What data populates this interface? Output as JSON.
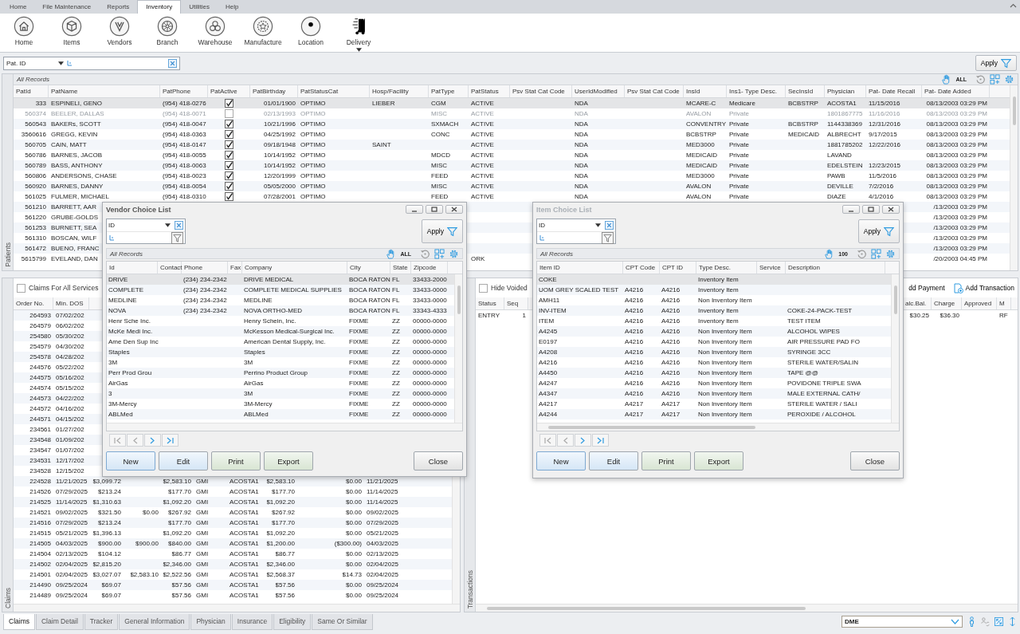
{
  "menu_tabs": [
    {
      "label": "Home",
      "selected": false
    },
    {
      "label": "File Maintenance",
      "selected": false
    },
    {
      "label": "Reports",
      "selected": false
    },
    {
      "label": "Inventory",
      "selected": true
    },
    {
      "label": "Utilities",
      "selected": false
    },
    {
      "label": "Help",
      "selected": false
    }
  ],
  "ribbon": [
    {
      "label": "Home",
      "kind": "home",
      "has_menu": false
    },
    {
      "label": "Items",
      "kind": "items",
      "has_menu": false
    },
    {
      "label": "Vendors",
      "kind": "vendors",
      "has_menu": false
    },
    {
      "label": "Branch",
      "kind": "branch",
      "has_menu": false
    },
    {
      "label": "Warehouse",
      "kind": "warehouse",
      "has_menu": false
    },
    {
      "label": "Manufacture",
      "kind": "manufacturer",
      "has_menu": false
    },
    {
      "label": "Location",
      "kind": "location",
      "has_menu": false
    },
    {
      "label": "Delivery",
      "kind": "delivery",
      "has_menu": true
    }
  ],
  "filter": {
    "field": "Pat. ID",
    "button": "Apply"
  },
  "records_bar": {
    "label": "All Records",
    "count": "ALL"
  },
  "patients": {
    "side_label": "Patients",
    "columns": [
      "PatId",
      "PatName",
      "PatPhone",
      "PatActive",
      "PatBirthday",
      "PatStatusCat",
      "Hosp/Facility",
      "PatType",
      "PatStatus",
      "Psv Stat Cat Code",
      "UserIdModified",
      "Psv Stat Cat Code",
      "InsId",
      "Ins1- Type Desc.",
      "SecInsId",
      "Physician",
      "Pat- Date Recall",
      "Pat- Date Added"
    ],
    "rows": [
      {
        "selected": true,
        "disabled": false,
        "active": true,
        "cells": [
          "333",
          "ESPINELI, GENO",
          "(954) 418-0276",
          null,
          "01/01/1900",
          "OPTIMO",
          "LIEBER",
          "CGM",
          "ACTIVE",
          null,
          "NDA",
          null,
          "MCARE-C",
          "Medicare",
          "BCBSTRP",
          "ACOSTA1",
          "11/15/2016",
          "08/13/2003 03:29 PM"
        ]
      },
      {
        "selected": false,
        "disabled": true,
        "active": false,
        "cells": [
          "560374",
          "BEELER, DALLAS",
          "(954) 418-0071",
          null,
          "02/13/1993",
          "OPTIMO",
          null,
          "MISC",
          "ACTIVE",
          null,
          "NDA",
          null,
          "AVALON",
          "Private",
          null,
          "1801867775",
          "11/16/2016",
          "08/13/2003 03:29 PM"
        ]
      },
      {
        "selected": false,
        "disabled": false,
        "active": true,
        "cells": [
          "560543",
          "BAKERs, SCOTT",
          "(954) 418-0047",
          null,
          "10/21/1996",
          "OPTIMO",
          null,
          "SXMACH",
          "ACTIVE",
          null,
          "NDA",
          null,
          "CONVENTRY",
          "Private",
          "BCBSTRP",
          "1144338369",
          "12/31/2016",
          "08/13/2003 03:29 PM"
        ]
      },
      {
        "selected": false,
        "disabled": false,
        "active": true,
        "cells": [
          "3560616",
          "GREGG, KEVIN",
          "(954) 418-0363",
          null,
          "04/25/1992",
          "OPTIMO",
          null,
          "CONC",
          "ACTIVE",
          null,
          "NDA",
          null,
          "BCBSTRP",
          "Private",
          "MEDICAID",
          "ALBRECHT",
          "9/17/2015",
          "08/13/2003 03:29 PM"
        ]
      },
      {
        "selected": false,
        "disabled": false,
        "active": true,
        "cells": [
          "560705",
          "CAIN, MATT",
          "(954) 418-0147",
          null,
          "09/18/1948",
          "OPTIMO",
          "SAINT",
          null,
          "ACTIVE",
          null,
          "NDA",
          null,
          "MED3000",
          "Private",
          null,
          "1881785202",
          "12/22/2016",
          "08/13/2003 03:29 PM"
        ]
      },
      {
        "selected": false,
        "disabled": false,
        "active": true,
        "cells": [
          "560786",
          "BARNES, JACOB",
          "(954) 418-0055",
          null,
          "10/14/1952",
          "OPTIMO",
          null,
          "MDCD",
          "ACTIVE",
          null,
          "NDA",
          null,
          "MEDICAID",
          "Private",
          null,
          "LAVAND",
          null,
          "08/13/2003 03:29 PM"
        ]
      },
      {
        "selected": false,
        "disabled": false,
        "active": true,
        "cells": [
          "560789",
          "BASS, ANTHONY",
          "(954) 418-0063",
          null,
          "10/14/1952",
          "OPTIMO",
          null,
          "MISC",
          "ACTIVE",
          null,
          "NDA",
          null,
          "MEDICAID",
          "Private",
          null,
          "EDELSTEIN",
          "12/23/2015",
          "08/13/2003 03:29 PM"
        ]
      },
      {
        "selected": false,
        "disabled": false,
        "active": true,
        "cells": [
          "560806",
          "ANDERSONS, CHASE",
          "(954) 418-0023",
          null,
          "12/20/1999",
          "OPTIMO",
          null,
          "FEED",
          "ACTIVE",
          null,
          "NDA",
          null,
          "MED3000",
          "Private",
          null,
          "PAWB",
          "11/5/2016",
          "08/13/2003 03:29 PM"
        ]
      },
      {
        "selected": false,
        "disabled": false,
        "active": true,
        "cells": [
          "560920",
          "BARNES, DANNY",
          "(954) 418-0054",
          null,
          "05/05/2000",
          "OPTIMO",
          null,
          "MISC",
          "ACTIVE",
          null,
          "NDA",
          null,
          "AVALON",
          "Private",
          null,
          "DEVILLE",
          "7/2/2016",
          "08/13/2003 03:29 PM"
        ]
      },
      {
        "selected": false,
        "disabled": false,
        "active": true,
        "cells": [
          "561025",
          "FULMER, MICHAEL",
          "(954) 418-0310",
          null,
          "07/28/2001",
          "OPTIMO",
          null,
          "FEED",
          "ACTIVE",
          null,
          "NDA",
          null,
          "AVALON",
          "Private",
          null,
          "DIAZE",
          "4/1/2016",
          "08/13/2003 03:29 PM"
        ]
      },
      {
        "selected": false,
        "disabled": false,
        "cells": [
          "561210",
          "BARRETT, AAR",
          null,
          null,
          null,
          null,
          null,
          null,
          null,
          null,
          null,
          null,
          null,
          null,
          null,
          null,
          null,
          "/13/2003 03:29 PM"
        ]
      },
      {
        "selected": false,
        "disabled": false,
        "cells": [
          "561220",
          "GRUBE-GOLDS",
          null,
          null,
          null,
          null,
          null,
          null,
          null,
          null,
          null,
          null,
          null,
          null,
          null,
          null,
          null,
          "/13/2003 03:29 PM"
        ]
      },
      {
        "selected": false,
        "disabled": false,
        "cells": [
          "561253",
          "BURNETT, SEA",
          null,
          null,
          null,
          null,
          null,
          null,
          null,
          null,
          null,
          null,
          null,
          null,
          null,
          null,
          null,
          "/13/2003 03:29 PM"
        ]
      },
      {
        "selected": false,
        "disabled": false,
        "cells": [
          "561310",
          "BOSCAN, WILF",
          null,
          null,
          null,
          null,
          null,
          null,
          null,
          null,
          null,
          null,
          null,
          null,
          null,
          null,
          null,
          "/13/2003 03:29 PM"
        ]
      },
      {
        "selected": false,
        "disabled": false,
        "cells": [
          "561472",
          "BUENO, FRANC",
          null,
          null,
          null,
          null,
          null,
          null,
          null,
          null,
          null,
          null,
          null,
          null,
          null,
          null,
          null,
          "/13/2003 03:29 PM"
        ]
      },
      {
        "selected": false,
        "disabled": false,
        "cells": [
          "5615799",
          "EVELAND, DAN",
          null,
          null,
          null,
          null,
          null,
          null,
          "ORK",
          null,
          null,
          null,
          null,
          null,
          null,
          null,
          null,
          "/20/2003 04:45 PM"
        ]
      }
    ]
  },
  "claims": {
    "side_label": "Claims",
    "all_services": {
      "label": "Claims For All Services",
      "checked": false
    },
    "columns": [
      "Order No.",
      "Min. DOS",
      null,
      null,
      null,
      null,
      null,
      null,
      null,
      null
    ],
    "rows": [
      {
        "cells": [
          "264593",
          "07/02/202",
          null,
          null,
          null,
          null,
          null,
          null,
          null,
          null
        ]
      },
      {
        "cells": [
          "264579",
          "06/02/202",
          null,
          null,
          null,
          null,
          null,
          null,
          null,
          null
        ]
      },
      {
        "cells": [
          "254580",
          "05/30/202",
          null,
          null,
          null,
          null,
          null,
          null,
          null,
          null
        ]
      },
      {
        "cells": [
          "254579",
          "04/30/202",
          null,
          null,
          null,
          null,
          null,
          null,
          null,
          null
        ]
      },
      {
        "cells": [
          "254578",
          "04/28/202",
          null,
          null,
          null,
          null,
          null,
          null,
          null,
          null
        ]
      },
      {
        "cells": [
          "244576",
          "05/22/202",
          null,
          null,
          null,
          null,
          null,
          null,
          null,
          null
        ]
      },
      {
        "cells": [
          "244575",
          "05/16/202",
          null,
          null,
          null,
          null,
          null,
          null,
          null,
          null
        ]
      },
      {
        "cells": [
          "244574",
          "05/15/202",
          null,
          null,
          null,
          null,
          null,
          null,
          null,
          null
        ]
      },
      {
        "cells": [
          "244573",
          "04/22/202",
          null,
          null,
          null,
          null,
          null,
          null,
          null,
          null
        ]
      },
      {
        "cells": [
          "244572",
          "04/16/202",
          null,
          null,
          null,
          null,
          null,
          null,
          null,
          null
        ]
      },
      {
        "cells": [
          "244571",
          "04/15/202",
          null,
          null,
          null,
          null,
          null,
          null,
          null,
          null
        ]
      },
      {
        "cells": [
          "234561",
          "01/27/202",
          null,
          null,
          null,
          null,
          null,
          null,
          null,
          null
        ]
      },
      {
        "cells": [
          "234548",
          "01/09/202",
          null,
          null,
          null,
          null,
          null,
          null,
          null,
          null
        ]
      },
      {
        "cells": [
          "234547",
          "01/07/202",
          null,
          null,
          null,
          null,
          null,
          null,
          null,
          null
        ]
      },
      {
        "cells": [
          "234531",
          "12/17/202",
          null,
          null,
          null,
          null,
          null,
          null,
          null,
          null
        ]
      },
      {
        "cells": [
          "234528",
          "12/15/202",
          null,
          null,
          null,
          null,
          null,
          null,
          null,
          null
        ]
      },
      {
        "cells": [
          "224528",
          "11/21/2025",
          "$3,099.72",
          null,
          "$2,583.10",
          "GMI",
          "ACOSTA1",
          "$2,583.10",
          "$0.00",
          "11/21/2025"
        ]
      },
      {
        "cells": [
          "214526",
          "07/29/2025",
          "$213.24",
          null,
          "$177.70",
          "GMI",
          "ACOSTA1",
          "$177.70",
          "$0.00",
          "11/14/2025"
        ]
      },
      {
        "cells": [
          "214525",
          "11/14/2025",
          "$1,310.63",
          null,
          "$1,092.20",
          "GMI",
          "ACOSTA1",
          "$1,092.20",
          "$0.00",
          "11/14/2025"
        ]
      },
      {
        "cells": [
          "214521",
          "09/02/2025",
          "$321.50",
          "$0.00",
          "$267.92",
          "GMI",
          "ACOSTA1",
          "$267.92",
          "$0.00",
          "09/02/2025"
        ]
      },
      {
        "cells": [
          "214516",
          "07/29/2025",
          "$213.24",
          null,
          "$177.70",
          "GMI",
          "ACOSTA1",
          "$177.70",
          "$0.00",
          "07/29/2025"
        ]
      },
      {
        "cells": [
          "214515",
          "05/21/2025",
          "$1,396.13",
          null,
          "$1,092.20",
          "GMI",
          "ACOSTA1",
          "$1,092.20",
          "$0.00",
          "05/21/2025"
        ]
      },
      {
        "cells": [
          "214505",
          "04/03/2025",
          "$900.00",
          "$900.00",
          "$840.00",
          "GMI",
          "ACOSTA1",
          "$1,200.00",
          "($300.00)",
          "04/03/2025"
        ]
      },
      {
        "cells": [
          "214504",
          "02/13/2025",
          "$104.12",
          null,
          "$86.77",
          "GMI",
          "ACOSTA1",
          "$86.77",
          "$0.00",
          "02/13/2025"
        ]
      },
      {
        "cells": [
          "214502",
          "02/04/2025",
          "$2,815.20",
          null,
          "$2,346.00",
          "GMI",
          "ACOSTA1",
          "$2,346.00",
          "$0.00",
          "02/04/2025"
        ]
      },
      {
        "cells": [
          "214501",
          "02/04/2025",
          "$3,027.07",
          "$2,583.10",
          "$2,522.56",
          "GMI",
          "ACOSTA1",
          "$2,568.37",
          "$14.73",
          "02/04/2025"
        ]
      },
      {
        "cells": [
          "214490",
          "09/25/2024",
          "$69.07",
          null,
          "$57.56",
          "GMI",
          "ACOSTA1",
          "$57.56",
          "$0.00",
          "09/25/2024"
        ]
      },
      {
        "cells": [
          "214489",
          "09/25/2024",
          "$69.07",
          null,
          "$57.56",
          "GMI",
          "ACOSTA1",
          "$57.56",
          "$0.00",
          "09/25/2024"
        ]
      }
    ]
  },
  "transactions": {
    "side_label": "Transactions",
    "hide_voided": {
      "label": "Hide Voided",
      "checked": false
    },
    "actions": [
      "dd Payment",
      "Add Transaction"
    ],
    "columns": [
      "Status",
      "Seq",
      "alc.Bal.",
      "Charge",
      "Approved",
      "M"
    ],
    "rows": [
      {
        "cells": [
          "ENTRY",
          "1",
          "$30.25",
          "$36.30",
          null,
          "RF"
        ]
      }
    ]
  },
  "dialogs": [
    {
      "title": "Vendor Choice List",
      "active": true,
      "filter": {
        "field": "ID",
        "button": "Apply"
      },
      "records": {
        "label": "All Records",
        "count": "ALL"
      },
      "columns": [
        "Id",
        "Contact",
        "Phone",
        "Fax",
        "Company",
        "City",
        "State",
        "Zipcode"
      ],
      "rows": [
        {
          "selected": true,
          "cells": [
            "DRIVE",
            null,
            "(234) 234-2342",
            null,
            "DRIVE MEDICAL",
            "BOCA RATON",
            "FL",
            "33433-2000"
          ]
        },
        {
          "selected": false,
          "cells": [
            "COMPLETE",
            null,
            "(234) 234-2342",
            null,
            "COMPLETE MEDICAL SUPPLIES",
            "BOCA RATON",
            "FL",
            "33433-0000"
          ]
        },
        {
          "selected": false,
          "cells": [
            "MEDLINE",
            null,
            "(234) 234-2342",
            null,
            "MEDLINE",
            "BOCA RATON",
            "FL",
            "33433-0000"
          ]
        },
        {
          "selected": false,
          "cells": [
            "NOVA",
            null,
            "(234) 234-2342",
            null,
            "NOVA ORTHO-MED",
            "BOCA RATON",
            "FL",
            "33343-4333"
          ]
        },
        {
          "selected": false,
          "cells": [
            "Henr Sche Inc.",
            null,
            null,
            null,
            "Henry Schein, Inc.",
            "FIXME",
            "ZZ",
            "00000-0000"
          ]
        },
        {
          "selected": false,
          "cells": [
            "McKe Medi Inc.",
            null,
            null,
            null,
            "McKesson Medical-Surgical Inc.",
            "FIXME",
            "ZZ",
            "00000-0000"
          ]
        },
        {
          "selected": false,
          "cells": [
            "Ame Den Sup Inc",
            null,
            null,
            null,
            "American Dental Supply, Inc.",
            "FIXME",
            "ZZ",
            "00000-0000"
          ]
        },
        {
          "selected": false,
          "cells": [
            "Staples",
            null,
            null,
            null,
            "Staples",
            "FIXME",
            "ZZ",
            "00000-0000"
          ]
        },
        {
          "selected": false,
          "cells": [
            "3M",
            null,
            null,
            null,
            "3M",
            "FIXME",
            "ZZ",
            "00000-0000"
          ]
        },
        {
          "selected": false,
          "cells": [
            "Perr Prod Grou",
            null,
            null,
            null,
            "Perrino Product Group",
            "FIXME",
            "ZZ",
            "00000-0000"
          ]
        },
        {
          "selected": false,
          "cells": [
            "AirGas",
            null,
            null,
            null,
            "AirGas",
            "FIXME",
            "ZZ",
            "00000-0000"
          ]
        },
        {
          "selected": false,
          "cells": [
            "3",
            null,
            null,
            null,
            "3M",
            "FIXME",
            "ZZ",
            "00000-0000"
          ]
        },
        {
          "selected": false,
          "cells": [
            "3M-Mercy",
            null,
            null,
            null,
            "3M-Mercy",
            "FIXME",
            "ZZ",
            "00000-0000"
          ]
        },
        {
          "selected": false,
          "cells": [
            "ABLMed",
            null,
            null,
            null,
            "ABLMed",
            "FIXME",
            "ZZ",
            "00000-0000"
          ]
        }
      ],
      "buttons": [
        {
          "label": "New",
          "kind": "create"
        },
        {
          "label": "Edit",
          "kind": "edit"
        },
        {
          "label": "Print",
          "kind": "print"
        },
        {
          "label": "Export",
          "kind": "export"
        },
        {
          "label": "Close",
          "kind": "close"
        }
      ]
    },
    {
      "title": "Item Choice List",
      "active": false,
      "filter": {
        "field": "ID",
        "button": "Apply"
      },
      "records": {
        "label": "All Records",
        "count": "100"
      },
      "columns": [
        "Item ID",
        "CPT Code",
        "CPT ID",
        "Type Desc.",
        "Service",
        "Description"
      ],
      "rows": [
        {
          "selected": true,
          "cells": [
            "COKE",
            null,
            null,
            "Inventory Item",
            null,
            null
          ]
        },
        {
          "selected": false,
          "cells": [
            "UOM GREY SCALED TEST",
            "A4216",
            "A4216",
            "Inventory Item",
            null,
            null
          ]
        },
        {
          "selected": false,
          "cells": [
            "AMH11",
            "A4216",
            "A4216",
            "Non Inventory Item",
            null,
            null
          ]
        },
        {
          "selected": false,
          "cells": [
            "INV-ITEM",
            "A4216",
            "A4216",
            "Inventory Item",
            null,
            "COKE-24-PACK-TEST"
          ]
        },
        {
          "selected": false,
          "cells": [
            "ITEM",
            "A4216",
            "A4216",
            "Inventory Item",
            null,
            "TEST ITEM"
          ]
        },
        {
          "selected": false,
          "cells": [
            "A4245",
            "A4216",
            "A4216",
            "Non Inventory Item",
            null,
            "ALCOHOL WIPES"
          ]
        },
        {
          "selected": false,
          "cells": [
            "E0197",
            "A4216",
            "A4216",
            "Non Inventory Item",
            null,
            "AIR PRESSURE PAD FO"
          ]
        },
        {
          "selected": false,
          "cells": [
            "A4208",
            "A4216",
            "A4216",
            "Non Inventory Item",
            null,
            "SYRINGE 3CC"
          ]
        },
        {
          "selected": false,
          "cells": [
            "A4216",
            "A4216",
            "A4216",
            "Non Inventory Item",
            null,
            "STERILE WATER/SALIN"
          ]
        },
        {
          "selected": false,
          "cells": [
            "A4450",
            "A4216",
            "A4216",
            "Non Inventory Item",
            null,
            "TAPE @@"
          ]
        },
        {
          "selected": false,
          "cells": [
            "A4247",
            "A4216",
            "A4216",
            "Non Inventory Item",
            null,
            "POVIDONE TRIPLE SWA"
          ]
        },
        {
          "selected": false,
          "cells": [
            "A4347",
            "A4216",
            "A4216",
            "Non Inventory Item",
            null,
            "MALE EXTERNAL CATH/"
          ]
        },
        {
          "selected": false,
          "cells": [
            "A4217",
            "A4217",
            "A4217",
            "Non Inventory Item",
            null,
            "STERILE WATER / SALI"
          ]
        },
        {
          "selected": false,
          "cells": [
            "A4244",
            "A4217",
            "A4217",
            "Non Inventory Item",
            null,
            "PEROXIDE  /  ALCOHOL"
          ]
        }
      ],
      "buttons": [
        {
          "label": "New",
          "kind": "create"
        },
        {
          "label": "Edit",
          "kind": "edit"
        },
        {
          "label": "Print",
          "kind": "print"
        },
        {
          "label": "Export",
          "kind": "export"
        },
        {
          "label": "Close",
          "kind": "close"
        }
      ]
    }
  ],
  "footer": {
    "tabs": [
      {
        "label": "Claims",
        "selected": true
      },
      {
        "label": "Claim Detail",
        "selected": false
      },
      {
        "label": "Tracker",
        "selected": false
      },
      {
        "label": "General Information",
        "selected": false
      },
      {
        "label": "Physician",
        "selected": false
      },
      {
        "label": "Insurance",
        "selected": false
      },
      {
        "label": "Eligibility",
        "selected": false
      },
      {
        "label": "Same Or Similar",
        "selected": false
      }
    ],
    "mode": "DME"
  }
}
